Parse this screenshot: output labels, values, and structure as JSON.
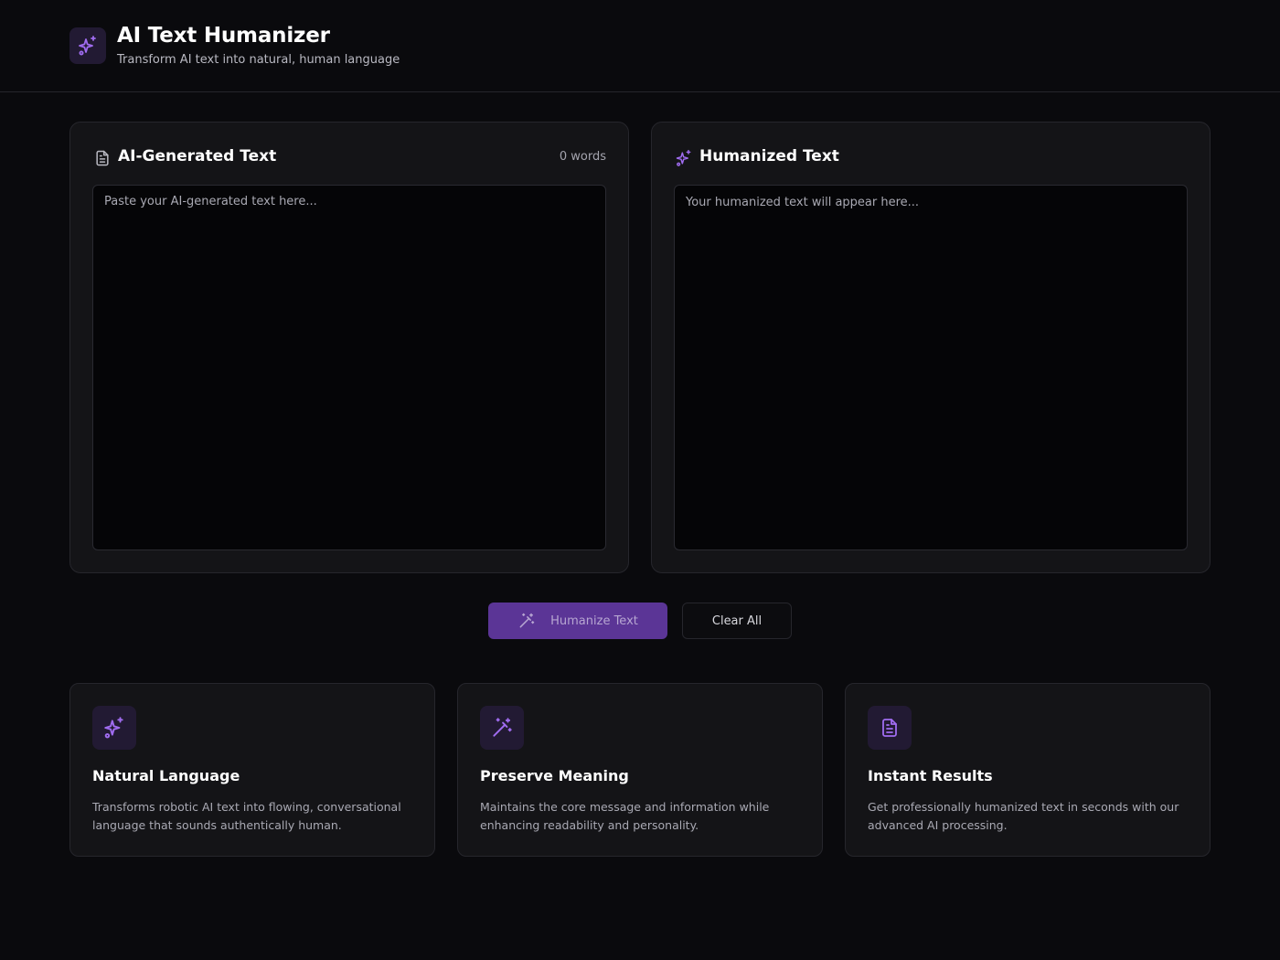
{
  "app": {
    "title": "AI Text Humanizer",
    "subtitle": "Transform AI text into natural, human language",
    "logo_icon": "sparkles-icon"
  },
  "input_panel": {
    "title": "AI-Generated Text",
    "icon": "document-icon",
    "word_count": "0 words",
    "value": "",
    "placeholder": "Paste your AI-generated text here..."
  },
  "output_panel": {
    "title": "Humanized Text",
    "icon": "sparkles-icon",
    "placeholder": "Your humanized text will appear here..."
  },
  "actions": {
    "humanize_label": "Humanize Text",
    "humanize_icon": "magic-wand-icon",
    "clear_label": "Clear All"
  },
  "features": [
    {
      "icon": "sparkles-icon",
      "title": "Natural Language",
      "description": "Transforms robotic AI text into flowing, conversational language that sounds authentically human."
    },
    {
      "icon": "magic-wand-icon",
      "title": "Preserve Meaning",
      "description": "Maintains the core message and information while enhancing readability and personality."
    },
    {
      "icon": "document-icon",
      "title": "Instant Results",
      "description": "Get professionally humanized text in seconds with our advanced AI processing."
    }
  ],
  "colors": {
    "background": "#0a0a0d",
    "panel": "#141417",
    "accent": "#a06cf0",
    "primary_button": "#5b3596",
    "icon_tile": "#221a33"
  }
}
